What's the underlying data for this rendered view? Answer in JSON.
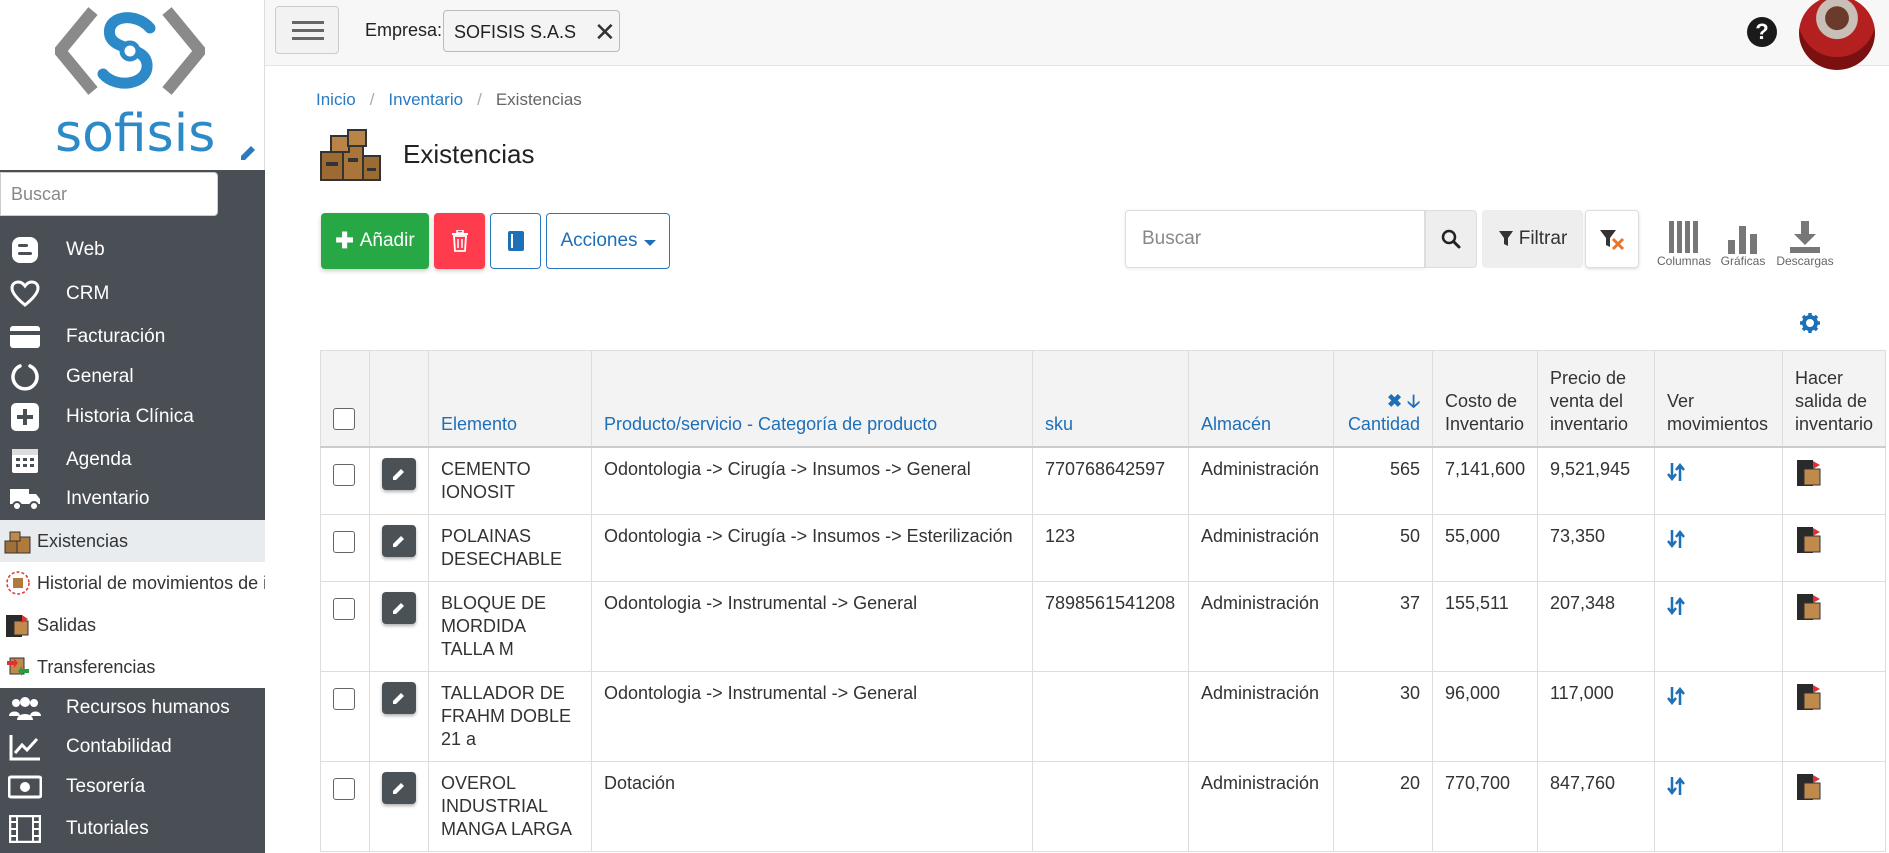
{
  "brand": {
    "name": "sofisis",
    "color": "#2d8ac9"
  },
  "sidebar": {
    "search_placeholder": "Buscar",
    "items": [
      {
        "label": "Web",
        "icon": "blog-icon"
      },
      {
        "label": "CRM",
        "icon": "heart-icon"
      },
      {
        "label": "Facturación",
        "icon": "credit-card-icon"
      },
      {
        "label": "General",
        "icon": "circle-notch-icon"
      },
      {
        "label": "Historia Clínica",
        "icon": "medical-plus-icon"
      },
      {
        "label": "Agenda",
        "icon": "calendar-icon"
      },
      {
        "label": "Inventario",
        "icon": "truck-icon"
      },
      {
        "label": "Recursos humanos",
        "icon": "users-icon"
      },
      {
        "label": "Contabilidad",
        "icon": "chart-line-icon"
      },
      {
        "label": "Tesorería",
        "icon": "money-bill-icon"
      },
      {
        "label": "Tutoriales",
        "icon": "film-icon"
      }
    ],
    "sub_items": [
      {
        "label": "Existencias",
        "icon": "boxes-icon",
        "active": true
      },
      {
        "label": "Historial de movimientos de inventario",
        "icon": "history-icon"
      },
      {
        "label": "Salidas",
        "icon": "box-out-icon"
      },
      {
        "label": "Transferencias",
        "icon": "transfer-icon"
      }
    ]
  },
  "topbar": {
    "empresa_label": "Empresa:",
    "empresa_value": "SOFISIS S.A.S"
  },
  "breadcrumb": [
    "Inicio",
    "Inventario",
    "Existencias"
  ],
  "page": {
    "title": "Existencias"
  },
  "toolbar": {
    "add_label": "Añadir",
    "actions_label": "Acciones",
    "search_placeholder": "Buscar",
    "filter_label": "Filtrar",
    "columns_label": "Columnas",
    "charts_label": "Gráficas",
    "downloads_label": "Descargas"
  },
  "table": {
    "headers": {
      "element": "Elemento",
      "product": "Producto/servicio - Categoría de producto",
      "sku": "sku",
      "warehouse": "Almacén",
      "quantity": "Cantidad",
      "cost": "Costo de Inventario",
      "price": "Precio de venta del inventario",
      "movements": "Ver movimientos",
      "output": "Hacer salida de inventario"
    },
    "rows": [
      {
        "element": "CEMENTO IONOSIT",
        "product": "Odontologia -> Cirugía -> Insumos -> General",
        "sku": "770768642597",
        "warehouse": "Administración",
        "quantity": "565",
        "cost": "7,141,600",
        "price": "9,521,945"
      },
      {
        "element": "POLAINAS DESECHABLE",
        "product": "Odontologia -> Cirugía -> Insumos -> Esterilización",
        "sku": "123",
        "warehouse": "Administración",
        "quantity": "50",
        "cost": "55,000",
        "price": "73,350"
      },
      {
        "element": "BLOQUE DE MORDIDA TALLA M",
        "product": "Odontologia -> Instrumental -> General",
        "sku": "7898561541208",
        "warehouse": "Administración",
        "quantity": "37",
        "cost": "155,511",
        "price": "207,348"
      },
      {
        "element": "TALLADOR DE FRAHM DOBLE 21 a",
        "product": "Odontologia -> Instrumental -> General",
        "sku": "",
        "warehouse": "Administración",
        "quantity": "30",
        "cost": "96,000",
        "price": "117,000"
      },
      {
        "element": "OVEROL INDUSTRIAL MANGA LARGA",
        "product": "Dotación",
        "sku": "",
        "warehouse": "Administración",
        "quantity": "20",
        "cost": "770,700",
        "price": "847,760"
      }
    ]
  },
  "colors": {
    "accent": "#1d6fb8",
    "add": "#28a745",
    "delete": "#ff3b4e",
    "sidebar": "#4a4f55"
  }
}
